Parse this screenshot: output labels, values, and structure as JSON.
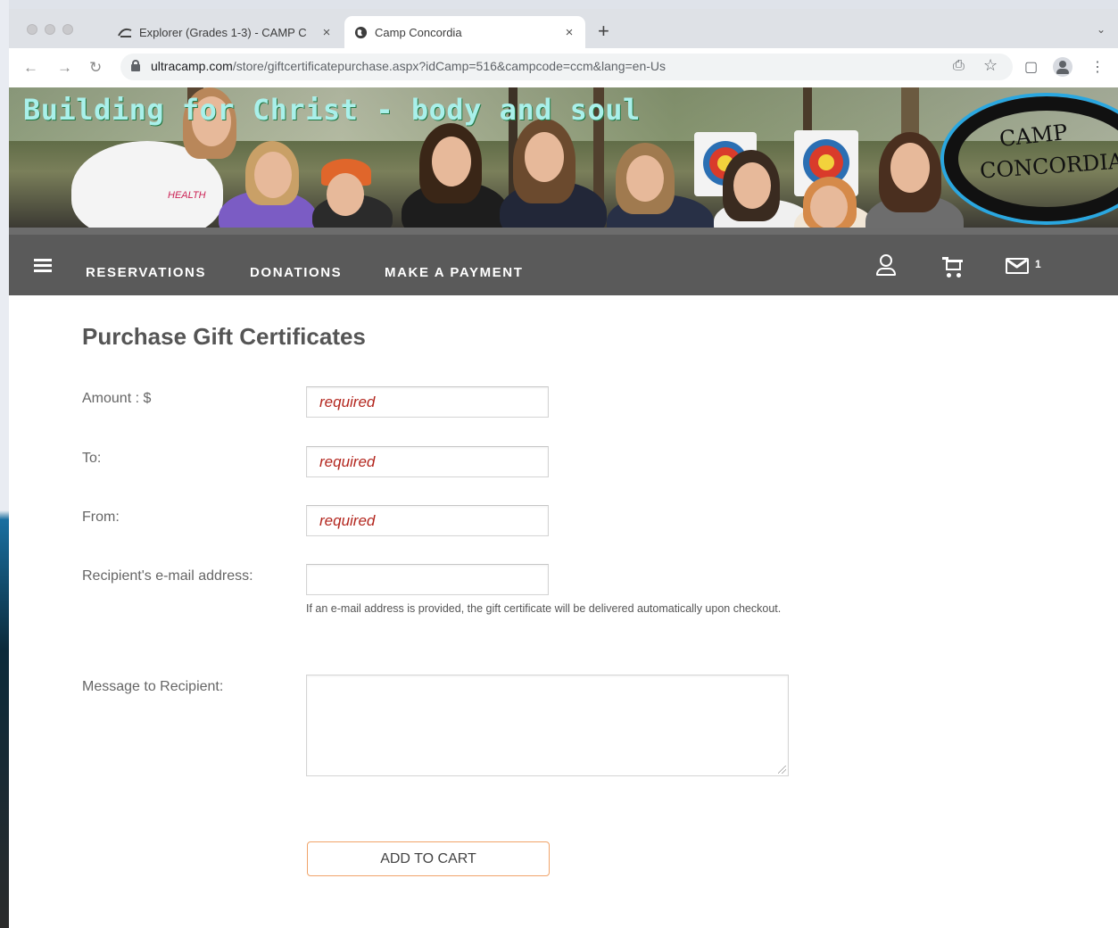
{
  "browser": {
    "tabs": [
      {
        "title": "Explorer (Grades 1-3) - CAMP C",
        "icon": "camp-logo-icon",
        "close": "×"
      },
      {
        "title": "Camp Concordia",
        "icon": "globe-icon",
        "close": "×"
      }
    ],
    "new_tab": "+",
    "tab_menu": "⌄",
    "url_host": "ultracamp.com",
    "url_path": "/store/giftcertificatepurchase.aspx?idCamp=516&campcode=ccm&lang=en-Us",
    "back": "←",
    "forward": "→",
    "reload": "↻",
    "share": "⎙",
    "bookmark": "☆",
    "sidepanel": "▢",
    "menu": "⋮"
  },
  "banner": {
    "tagline": "Building for Christ - body and soul",
    "logo_line1": "CAMP",
    "logo_line2": "CONCORDIA",
    "shirt_text": "HEALTH"
  },
  "nav": {
    "links": [
      "RESERVATIONS",
      "DONATIONS",
      "MAKE A PAYMENT"
    ],
    "mail_count": "1"
  },
  "form": {
    "title": "Purchase Gift Certificates",
    "amount_label": "Amount : $",
    "amount_placeholder": "required",
    "to_label": "To:",
    "to_placeholder": "required",
    "from_label": "From:",
    "from_placeholder": "required",
    "email_label": "Recipient's e-mail address:",
    "email_hint": "If an e-mail address is provided, the gift certificate will be delivered automatically upon checkout.",
    "message_label": "Message to Recipient:",
    "submit_label": "ADD TO CART"
  },
  "colors": {
    "nav_bg": "#5a5a5a",
    "required_text": "#b3261e",
    "button_border": "#f0a46a",
    "banner_text": "#a9f0ea",
    "logo_accent": "#2aa7e0"
  }
}
